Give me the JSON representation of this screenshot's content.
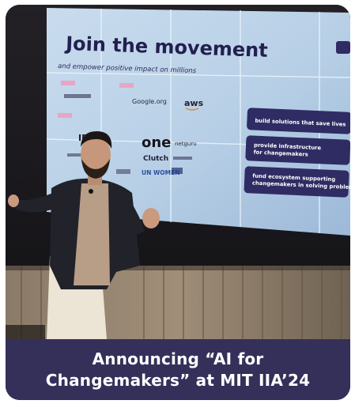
{
  "slide": {
    "title": "Join the movement",
    "subtitle": "and empower positive impact on millions",
    "points": [
      "build solutions that save lives",
      "provide infrastructure\nfor changemakers",
      "fund ecosystem supporting\nchangemakers in solving problems"
    ],
    "logos": [
      "Google.org",
      "aws",
      "one",
      "netguru",
      "Clutch",
      "UN WOMEN",
      "IDEO"
    ]
  },
  "caption": {
    "line1": "Announcing “AI for",
    "line2": "Changemakers” at MIT IIA’24"
  },
  "colors": {
    "caption_bg": "#34305a",
    "screen_bg": "#bcd4e8",
    "stage_bg": "#1d1b1f"
  }
}
